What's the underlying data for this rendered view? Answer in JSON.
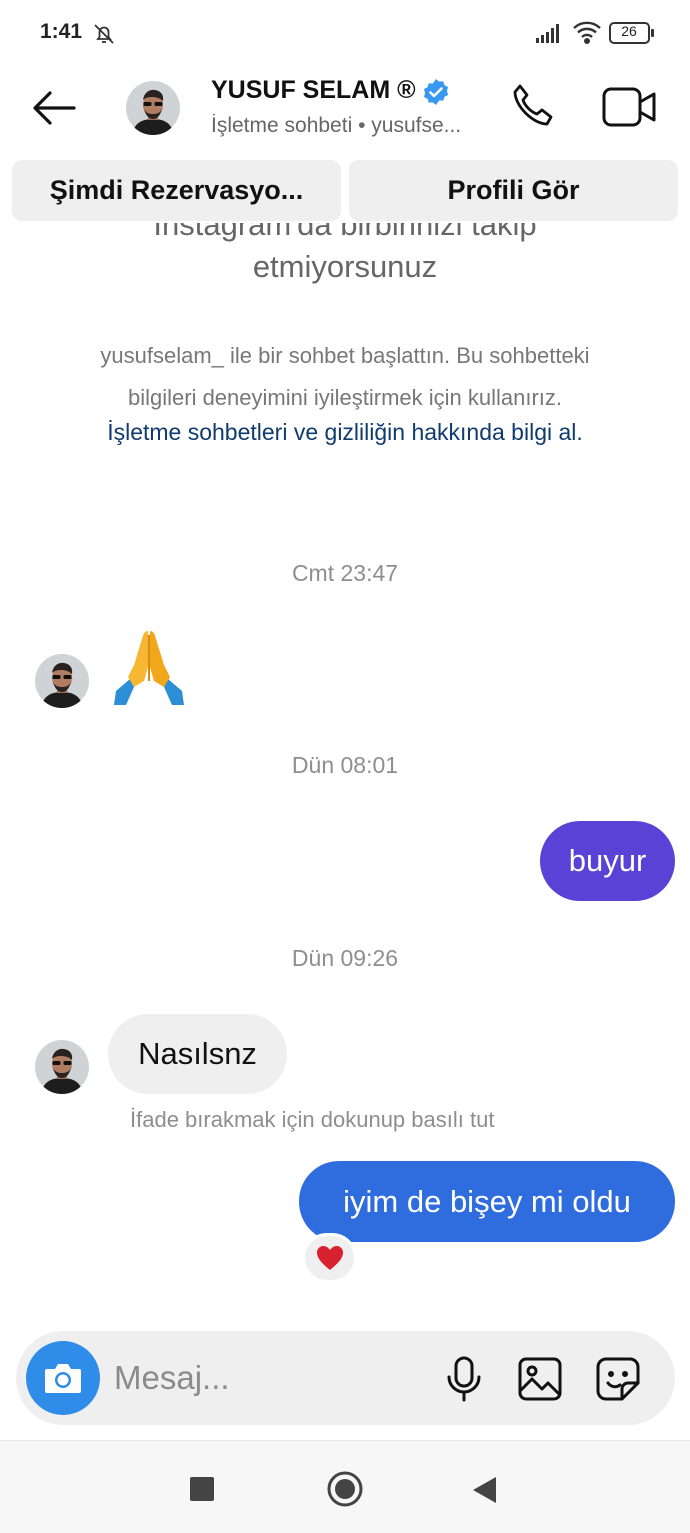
{
  "status_bar": {
    "time": "1:41",
    "battery": "26",
    "icons": [
      "bell-off-icon",
      "signal-icon",
      "wifi-icon",
      "battery-icon"
    ]
  },
  "header": {
    "name": "YUSUF SELAM ®",
    "subtitle": "İşletme sohbeti • yusufse...",
    "verified_color": "#3897f0"
  },
  "actions": {
    "reserve_label": "Şimdi Rezervasyo...",
    "profile_label": "Profili Gör"
  },
  "thread": {
    "follow_note_line1": "Instagram'da birbirinizi takip",
    "follow_note_line2": "etmiyorsunuz",
    "info_line1": "yusufselam_ ile bir sohbet başlattın. Bu sohbetteki",
    "info_line2": "bilgileri deneyimini iyileştirmek için kullanırız.",
    "info_link": "İşletme sohbetleri ve gizliliğin hakkında bilgi al."
  },
  "messages": [
    {
      "timestamp": "Cmt 23:47"
    },
    {
      "timestamp": "Dün 08:01",
      "text": "buyur",
      "from": "me",
      "color": "#5b42d6"
    },
    {
      "timestamp": "Dün 09:26",
      "text": "Nasılsnz",
      "from": "them"
    },
    {
      "hint": "İfade bırakmak için dokunup basılı tut"
    },
    {
      "text": "iyim de bişey mi oldu",
      "from": "me",
      "color": "#2f6ddf"
    }
  ],
  "composer": {
    "placeholder": "Mesaj...",
    "camera_color": "#2f8ce8"
  }
}
